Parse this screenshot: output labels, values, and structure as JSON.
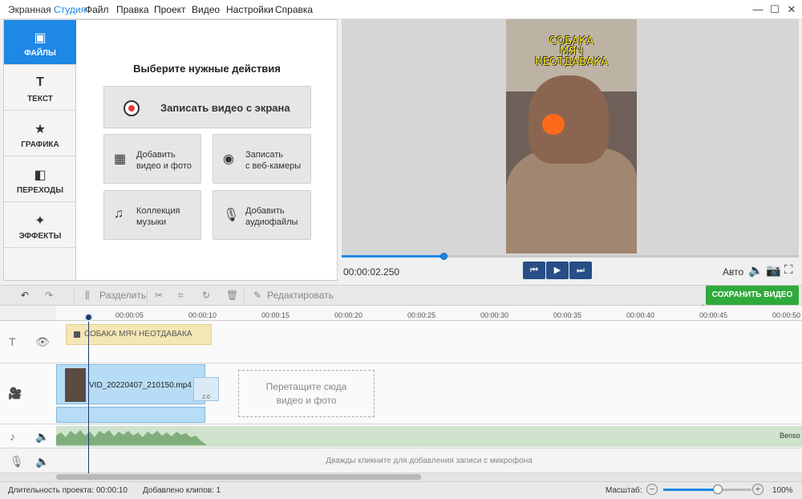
{
  "app": {
    "title_main": "Экранная",
    "title_accent": "Студия"
  },
  "menu": [
    "Файл",
    "Правка",
    "Проект",
    "Видео",
    "Настройки",
    "Справка"
  ],
  "window_controls": {
    "minimize": "—",
    "maximize": "☐",
    "close": "✕"
  },
  "sidebar": {
    "items": [
      {
        "label": "ФАЙЛЫ",
        "icon": "image-icon",
        "glyph": "▣",
        "active": true
      },
      {
        "label": "ТЕКСТ",
        "icon": "text-icon",
        "glyph": "T",
        "active": false
      },
      {
        "label": "ГРАФИКА",
        "icon": "star-icon",
        "glyph": "★",
        "active": false
      },
      {
        "label": "ПЕРЕХОДЫ",
        "icon": "transitions-icon",
        "glyph": "◧",
        "active": false
      },
      {
        "label": "ЭФФЕКТЫ",
        "icon": "magic-wand-icon",
        "glyph": "✦",
        "active": false
      }
    ]
  },
  "actions": {
    "title": "Выберите нужные действия",
    "record": "Записать видео с экрана",
    "add_media": "Добавить\nвидео и фото",
    "webcam": "Записать\nс веб-камеры",
    "music": "Коллекция\nмузыки",
    "audio": "Добавить\nаудиофайлы"
  },
  "preview": {
    "overlay_text": [
      "СОБАКА",
      "МЯЧ",
      "НЕОТДАВАКА"
    ],
    "timecode": "00:00:02.250",
    "progress": 0.224,
    "auto_label": "Авто"
  },
  "toolbar": {
    "split": "Разделить",
    "edit": "Редактировать",
    "save": "СОХРАНИТЬ ВИДЕО"
  },
  "ruler": {
    "ticks": [
      "00:00:05",
      "00:00:10",
      "00:00:15",
      "00:00:20",
      "00:00:25",
      "00:00:30",
      "00:00:35",
      "00:00:40",
      "00:00:45",
      "00:00:50"
    ]
  },
  "timeline": {
    "text_clip": "СОБАКА  МЯЧ  НЕОТДАВАКА",
    "video_clip": "VID_20220407_210150.mp4",
    "transition_duration": "2.0",
    "drop_zone": "Перетащите сюда\nвидео и фото",
    "music_name": "Benso",
    "mic_hint": "Дважды кликните для добавления записи с микрофона"
  },
  "status": {
    "duration_label": "Длительность проекта:",
    "duration_value": "00:00:10",
    "clips_label": "Добавлено клипов: 1",
    "zoom_label": "Масштаб:",
    "zoom_value": "100%",
    "zoom_level": 0.62
  },
  "colors": {
    "accent": "#1e88e5",
    "save": "#2eaa3a",
    "arrow": "#e02020"
  }
}
